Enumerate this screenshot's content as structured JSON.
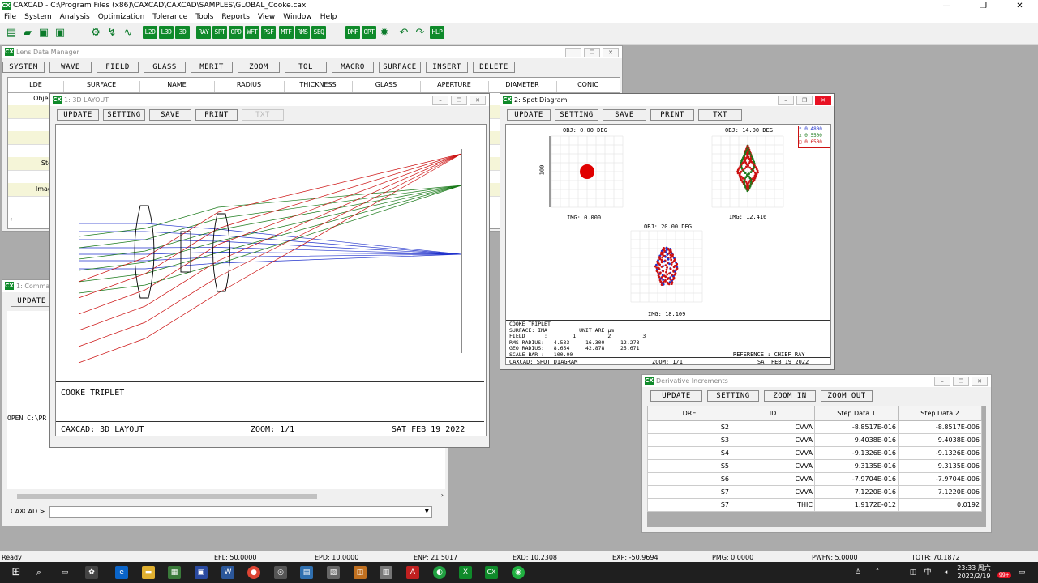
{
  "app": {
    "title": "CAXCAD - C:\\Program Files (x86)\\CAXCAD\\CAXCAD\\SAMPLES\\GLOBAL_Cooke.cax",
    "icon": "CX"
  },
  "menu": [
    "File",
    "System",
    "Analysis",
    "Optimization",
    "Tolerance",
    "Tools",
    "Reports",
    "View",
    "Window",
    "Help"
  ],
  "toolbar": {
    "labels": [
      "L2D",
      "L3D",
      "3D",
      "RAY",
      "SPT",
      "OPD",
      "WFT",
      "PSF",
      "MTF",
      "RMS",
      "SEQ",
      "DMF",
      "OPT",
      "HLP"
    ]
  },
  "lde": {
    "title": "Lens Data Manager",
    "buttons": [
      "SYSTEM",
      "WAVE",
      "FIELD",
      "GLASS",
      "MERIT",
      "ZOOM",
      "TOL",
      "MACRO",
      "SURFACE",
      "INSERT",
      "DELETE"
    ],
    "columns": [
      "LDE",
      "SURFACE",
      "NAME",
      "RADIUS",
      "THICKNESS",
      "GLASS",
      "APERTURE",
      "DIAMETER",
      "CONIC"
    ],
    "rows": [
      "Objec",
      "",
      "",
      "",
      "",
      "Sto",
      "",
      "Imag"
    ]
  },
  "command": {
    "title": "1: Comma",
    "button": "UPDATE",
    "text": "OPEN C:\\PR",
    "prompt": "CAXCAD >"
  },
  "layout3d": {
    "title": "1: 3D LAYOUT",
    "buttons": [
      "UPDATE",
      "SETTING",
      "SAVE",
      "PRINT",
      "TXT"
    ],
    "caption": "COOKE TRIPLET",
    "footer_left": "CAXCAD: 3D LAYOUT",
    "footer_zoom": "ZOOM: 1/1",
    "footer_date": "SAT FEB 19 2022",
    "ray_colors": [
      "#2233cc",
      "#1a7a1a",
      "#cc1111"
    ]
  },
  "spot": {
    "title": "2: Spot Diagram",
    "buttons": [
      "UPDATE",
      "SETTING",
      "SAVE",
      "PRINT",
      "TXT"
    ],
    "obj_labels": [
      "OBJ: 0.00 DEG",
      "OBJ: 14.00 DEG",
      "OBJ: 20.00 DEG"
    ],
    "img_labels": [
      "IMG: 0.000",
      "IMG: 12.416",
      "IMG: 18.109"
    ],
    "scale_label": "100",
    "legend": [
      "0.4800",
      "0.5500",
      "0.6500"
    ],
    "legend_colors": [
      "#2233cc",
      "#1a7a1a",
      "#cc1111"
    ],
    "info": {
      "line1": "COOKE TRIPLET",
      "line2": "SURFACE: IMA",
      "unit": "UNIT ARE µm",
      "field_label": "FIELD      :",
      "field_vals": [
        "1",
        "2",
        "3"
      ],
      "rms_label": "RMS RADIUS:",
      "rms_vals": [
        "4.533",
        "16.300",
        "12.273"
      ],
      "geo_label": "GEO RADIUS:",
      "geo_vals": [
        "8.654",
        "42.878",
        "25.671"
      ],
      "scale_text": "SCALE BAR :   100.00",
      "reference": "REFERENCE : CHIEF RAY"
    },
    "footer_left": "CAXCAD: SPOT DIAGRAM",
    "footer_zoom": "ZOOM: 1/1",
    "footer_date": "SAT FEB 19 2022"
  },
  "deriv": {
    "title": "Derivative Increments",
    "buttons": [
      "UPDATE",
      "SETTING",
      "ZOOM IN",
      "ZOOM OUT"
    ],
    "columns": [
      "DRE",
      "ID",
      "Step Data 1",
      "Step Data 2"
    ],
    "rows": [
      [
        "S2",
        "CVVA",
        "-8.8517E-016",
        "-8.8517E-006"
      ],
      [
        "S3",
        "CVVA",
        "9.4038E-016",
        "9.4038E-006"
      ],
      [
        "S4",
        "CVVA",
        "-9.1326E-016",
        "-9.1326E-006"
      ],
      [
        "S5",
        "CVVA",
        "9.3135E-016",
        "9.3135E-006"
      ],
      [
        "S6",
        "CVVA",
        "-7.9704E-016",
        "-7.9704E-006"
      ],
      [
        "S7",
        "CVVA",
        "7.1220E-016",
        "7.1220E-006"
      ],
      [
        "S7",
        "THIC",
        "1.9172E-012",
        "0.0192"
      ]
    ]
  },
  "status": {
    "ready": "Ready",
    "efl": "EFL: 50.0000",
    "epd": "EPD: 10.0000",
    "enp": "ENP: 21.5017",
    "exd": "EXD: 10.2308",
    "exp": "EXP: -50.9694",
    "pmg": "PMG: 0.0000",
    "pwfn": "PWFN: 5.0000",
    "totr": "TOTR: 70.1872"
  },
  "taskbar": {
    "time": "23:33 周六",
    "date": "2022/2/19",
    "ime": "中",
    "badge": "99+"
  }
}
